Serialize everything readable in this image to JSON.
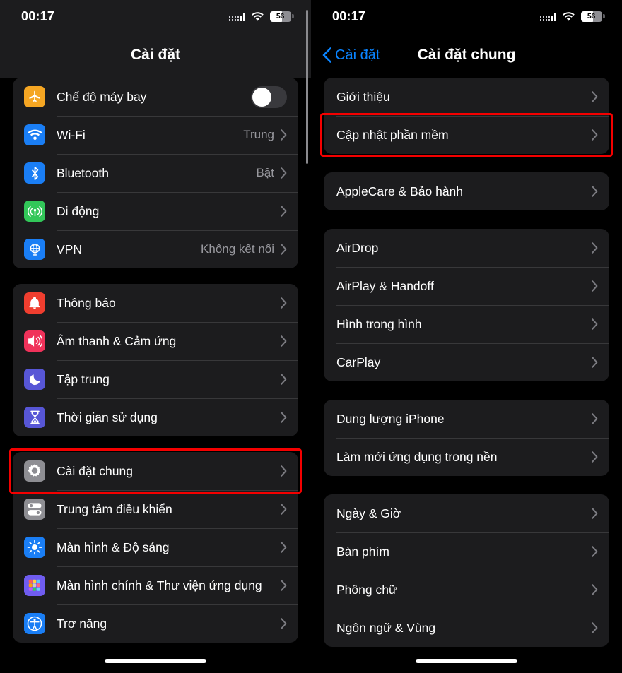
{
  "status_bar": {
    "time": "00:17",
    "battery_percent": "56",
    "cellular_icon": "cellular-signal-icon",
    "wifi_icon": "wifi-icon",
    "battery_icon": "battery-icon"
  },
  "colors": {
    "highlight": "#f40000",
    "accent_blue": "#0a84ff",
    "group_bg": "#1c1c1e",
    "screen_bg": "#000000",
    "value_text": "#98989e"
  },
  "left_screen": {
    "title": "Cài đặt",
    "groups": [
      {
        "rows": [
          {
            "label": "Chế độ máy bay",
            "icon": "airplane-icon",
            "icon_color": "#f5a623",
            "accessory": "toggle",
            "toggle_on": false
          },
          {
            "label": "Wi-Fi",
            "icon": "wifi-icon",
            "icon_color": "#1a7ef5",
            "value": "Trung",
            "accessory": "chevron"
          },
          {
            "label": "Bluetooth",
            "icon": "bluetooth-icon",
            "icon_color": "#1a7ef5",
            "value": "Bật",
            "accessory": "chevron"
          },
          {
            "label": "Di động",
            "icon": "cellular-icon",
            "icon_color": "#32c759",
            "value": "",
            "accessory": "chevron"
          },
          {
            "label": "VPN",
            "icon": "vpn-globe-icon",
            "icon_color": "#1a7ef5",
            "value": "Không kết nối",
            "accessory": "chevron"
          }
        ]
      },
      {
        "rows": [
          {
            "label": "Thông báo",
            "icon": "bell-icon",
            "icon_color": "#f03e2f",
            "value": "",
            "accessory": "chevron"
          },
          {
            "label": "Âm thanh & Cảm ứng",
            "icon": "speaker-icon",
            "icon_color": "#f0325a",
            "value": "",
            "accessory": "chevron"
          },
          {
            "label": "Tập trung",
            "icon": "moon-icon",
            "icon_color": "#5756d6",
            "value": "",
            "accessory": "chevron"
          },
          {
            "label": "Thời gian sử dụng",
            "icon": "hourglass-icon",
            "icon_color": "#5756d6",
            "value": "",
            "accessory": "chevron"
          }
        ]
      },
      {
        "rows": [
          {
            "label": "Cài đặt chung",
            "icon": "gear-icon",
            "icon_color": "#8e8e93",
            "value": "",
            "accessory": "chevron",
            "highlighted": true
          },
          {
            "label": "Trung tâm điều khiển",
            "icon": "control-center-icon",
            "icon_color": "#8e8e93",
            "value": "",
            "accessory": "chevron"
          },
          {
            "label": "Màn hình & Độ sáng",
            "icon": "brightness-icon",
            "icon_color": "#1a7ef5",
            "value": "",
            "accessory": "chevron"
          },
          {
            "label": "Màn hình chính & Thư viện ứng dụng",
            "icon": "app-library-icon",
            "icon_color": "#6f5cf0",
            "value": "",
            "accessory": "chevron"
          },
          {
            "label": "Trợ năng",
            "icon": "accessibility-icon",
            "icon_color": "#1a7ef5",
            "value": "",
            "accessory": "chevron",
            "clipped": true
          }
        ]
      }
    ]
  },
  "right_screen": {
    "title": "Cài đặt chung",
    "back_label": "Cài đặt",
    "back_icon": "chevron-left-icon",
    "groups": [
      {
        "rows": [
          {
            "label": "Giới thiệu",
            "accessory": "chevron"
          },
          {
            "label": "Cập nhật phần mềm",
            "accessory": "chevron",
            "highlighted": true
          }
        ]
      },
      {
        "rows": [
          {
            "label": "AppleCare & Bảo hành",
            "accessory": "chevron"
          }
        ]
      },
      {
        "rows": [
          {
            "label": "AirDrop",
            "accessory": "chevron"
          },
          {
            "label": "AirPlay & Handoff",
            "accessory": "chevron"
          },
          {
            "label": "Hình trong hình",
            "accessory": "chevron"
          },
          {
            "label": "CarPlay",
            "accessory": "chevron"
          }
        ]
      },
      {
        "rows": [
          {
            "label": "Dung lượng iPhone",
            "accessory": "chevron"
          },
          {
            "label": "Làm mới ứng dụng trong nền",
            "accessory": "chevron"
          }
        ]
      },
      {
        "rows": [
          {
            "label": "Ngày & Giờ",
            "accessory": "chevron"
          },
          {
            "label": "Bàn phím",
            "accessory": "chevron"
          },
          {
            "label": "Phông chữ",
            "accessory": "chevron"
          },
          {
            "label": "Ngôn ngữ & Vùng",
            "accessory": "chevron",
            "clipped": true
          }
        ]
      }
    ]
  }
}
